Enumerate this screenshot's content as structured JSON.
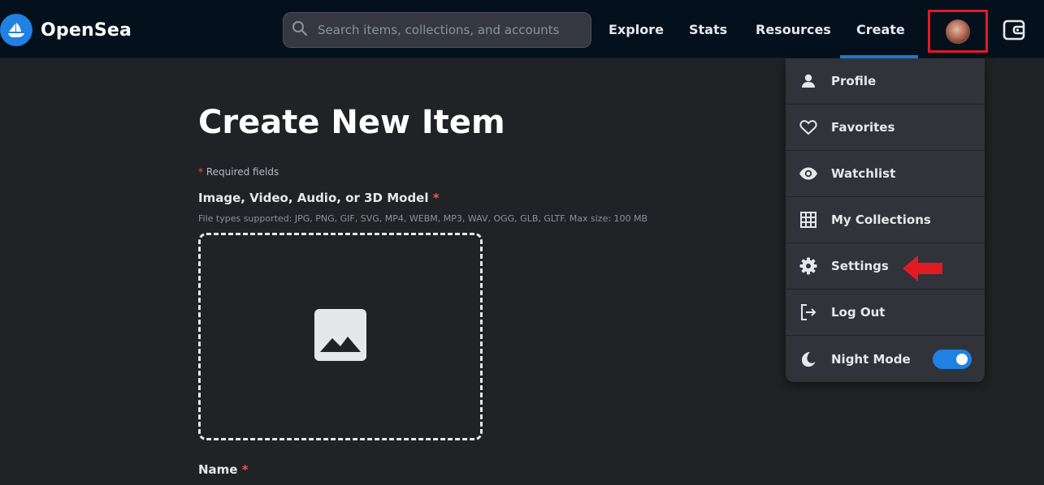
{
  "navbar": {
    "brand": "OpenSea",
    "search_placeholder": "Search items, collections, and accounts",
    "links": [
      "Explore",
      "Stats",
      "Resources",
      "Create"
    ],
    "active_link": "Create"
  },
  "main": {
    "title": "Create New Item",
    "required_note": "Required fields",
    "media_label": "Image, Video, Audio, or 3D Model",
    "file_types": "File types supported: JPG, PNG, GIF, SVG, MP4, WEBM, MP3, WAV, OGG, GLB, GLTF. Max size: 100 MB",
    "name_label": "Name",
    "required_marker": "*"
  },
  "dropdown": {
    "items": [
      {
        "label": "Profile",
        "icon": "person-icon"
      },
      {
        "label": "Favorites",
        "icon": "heart-icon"
      },
      {
        "label": "Watchlist",
        "icon": "eye-icon"
      },
      {
        "label": "My Collections",
        "icon": "grid-icon"
      },
      {
        "label": "Settings",
        "icon": "gear-icon"
      },
      {
        "label": "Log Out",
        "icon": "logout-icon"
      },
      {
        "label": "Night Mode",
        "icon": "moon-icon"
      }
    ],
    "night_mode_on": true
  },
  "colors": {
    "navbar_bg": "#04111d",
    "page_bg": "#202225",
    "accent": "#2081e2",
    "highlight_red": "#e21b23"
  }
}
